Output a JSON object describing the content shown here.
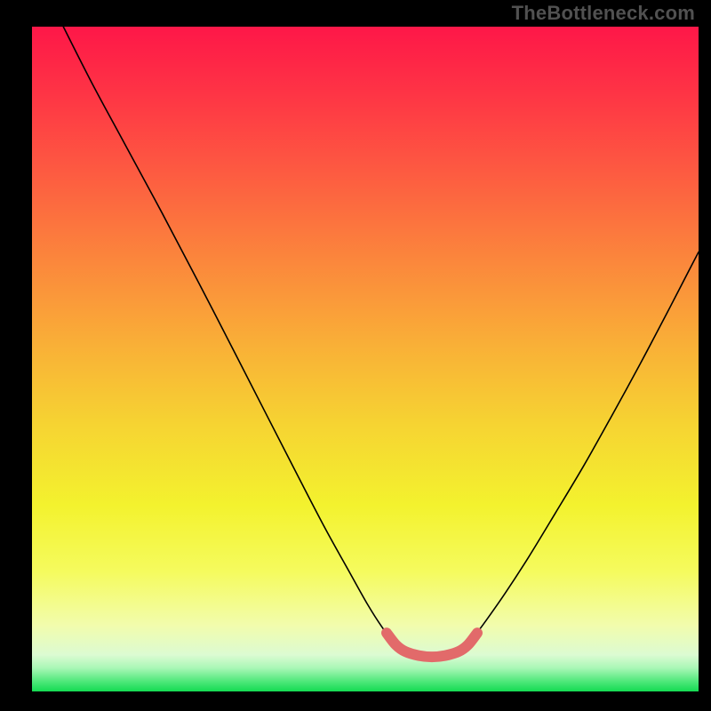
{
  "watermark": "TheBottleneck.com",
  "colors": {
    "frame": "#000000",
    "curve": "#000000",
    "valley_stroke": "#E26A6A",
    "gradient_stops": [
      {
        "offset": 0.0,
        "color": "#FE1748"
      },
      {
        "offset": 0.1,
        "color": "#FE3445"
      },
      {
        "offset": 0.22,
        "color": "#FD5B41"
      },
      {
        "offset": 0.35,
        "color": "#FB863C"
      },
      {
        "offset": 0.48,
        "color": "#F9B037"
      },
      {
        "offset": 0.6,
        "color": "#F6D432"
      },
      {
        "offset": 0.72,
        "color": "#F3F22E"
      },
      {
        "offset": 0.82,
        "color": "#F5FB5E"
      },
      {
        "offset": 0.9,
        "color": "#F2FCAC"
      },
      {
        "offset": 0.945,
        "color": "#DCFBD2"
      },
      {
        "offset": 0.965,
        "color": "#A8F7B6"
      },
      {
        "offset": 0.985,
        "color": "#4EE87A"
      },
      {
        "offset": 1.0,
        "color": "#14DB52"
      }
    ]
  },
  "chart_data": {
    "type": "line",
    "title": "",
    "xlabel": "",
    "ylabel": "",
    "xlim": [
      0,
      1
    ],
    "ylim": [
      0,
      1
    ],
    "note": "Abstract bottleneck curve; x/y are normalized to the plot area. y=0 is the top edge, y=1 is the bottom edge. Two thin black curves descend from the top edges toward a flat valley near the bottom center; a short thick pink arc marks the valley.",
    "series": [
      {
        "name": "left-curve",
        "stroke": "#000000",
        "width": 1.6,
        "points": [
          {
            "x": 0.047,
            "y": 0.0
          },
          {
            "x": 0.09,
            "y": 0.085
          },
          {
            "x": 0.14,
            "y": 0.178
          },
          {
            "x": 0.195,
            "y": 0.28
          },
          {
            "x": 0.25,
            "y": 0.385
          },
          {
            "x": 0.305,
            "y": 0.492
          },
          {
            "x": 0.355,
            "y": 0.59
          },
          {
            "x": 0.4,
            "y": 0.678
          },
          {
            "x": 0.44,
            "y": 0.755
          },
          {
            "x": 0.476,
            "y": 0.82
          },
          {
            "x": 0.504,
            "y": 0.87
          },
          {
            "x": 0.525,
            "y": 0.903
          },
          {
            "x": 0.54,
            "y": 0.922
          }
        ]
      },
      {
        "name": "right-curve",
        "stroke": "#000000",
        "width": 1.6,
        "points": [
          {
            "x": 0.66,
            "y": 0.922
          },
          {
            "x": 0.68,
            "y": 0.895
          },
          {
            "x": 0.71,
            "y": 0.852
          },
          {
            "x": 0.745,
            "y": 0.798
          },
          {
            "x": 0.785,
            "y": 0.732
          },
          {
            "x": 0.828,
            "y": 0.66
          },
          {
            "x": 0.87,
            "y": 0.585
          },
          {
            "x": 0.912,
            "y": 0.508
          },
          {
            "x": 0.952,
            "y": 0.432
          },
          {
            "x": 0.985,
            "y": 0.368
          },
          {
            "x": 1.0,
            "y": 0.339
          }
        ]
      },
      {
        "name": "valley-arc",
        "stroke": "#E26A6A",
        "width": 12,
        "points": [
          {
            "x": 0.532,
            "y": 0.912
          },
          {
            "x": 0.546,
            "y": 0.93
          },
          {
            "x": 0.56,
            "y": 0.94
          },
          {
            "x": 0.58,
            "y": 0.946
          },
          {
            "x": 0.6,
            "y": 0.948
          },
          {
            "x": 0.62,
            "y": 0.946
          },
          {
            "x": 0.64,
            "y": 0.94
          },
          {
            "x": 0.654,
            "y": 0.93
          },
          {
            "x": 0.668,
            "y": 0.912
          }
        ]
      }
    ]
  }
}
